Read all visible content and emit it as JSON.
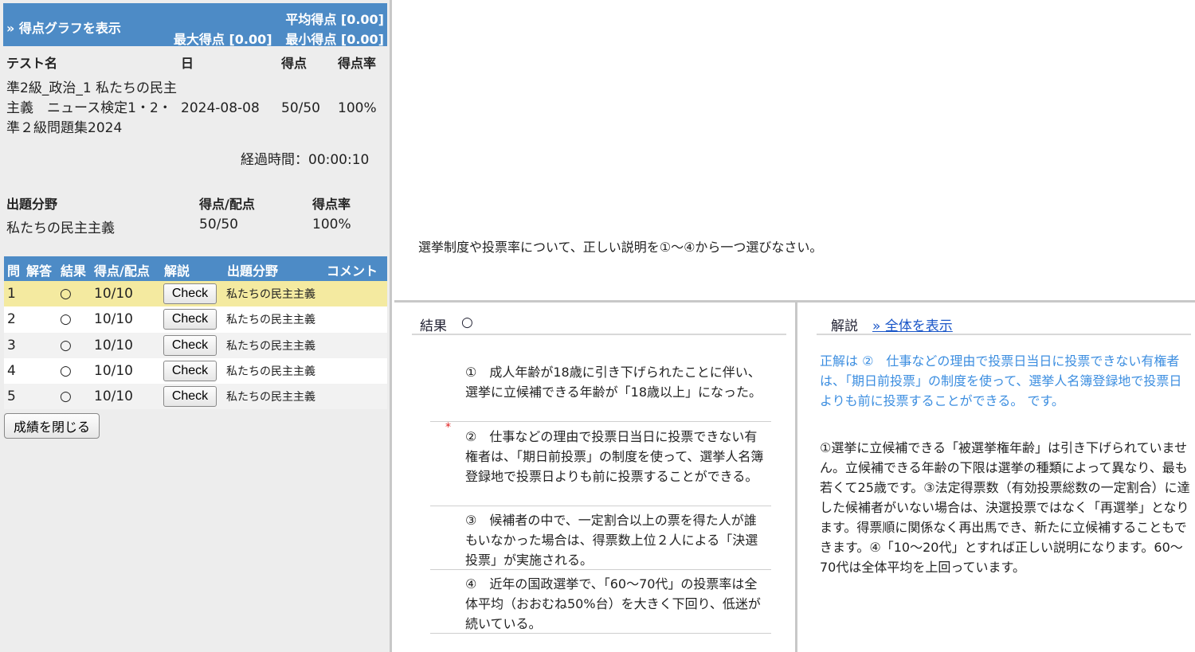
{
  "graph_bar": {
    "link": "» 得点グラフを表示",
    "avg": "平均得点 [0.00]",
    "max": "最大得点 [0.00]",
    "min": "最小得点 [0.00]"
  },
  "score_table": {
    "headers": [
      "テスト名",
      "日",
      "得点",
      "得点率"
    ],
    "test_name": "準2級_政治_1 私たちの民主主義　ニュース検定1・2・準２級問題集2024",
    "date": "2024-08-08",
    "score": "50/50",
    "rate": "100%"
  },
  "elapsed": "経過時間：00:00:10",
  "field_table": {
    "headers": [
      "出題分野",
      "得点/配点",
      "得点率"
    ],
    "field": "私たちの民主主義",
    "score": "50/50",
    "rate": "100%"
  },
  "question_table": {
    "headers": [
      "問",
      "解答",
      "結果",
      "得点/配点",
      "解説",
      "出題分野",
      "コメント"
    ],
    "rows": [
      {
        "num": "1",
        "result": "○",
        "score": "10/10",
        "button": "Check",
        "field": "私たちの民主主義"
      },
      {
        "num": "2",
        "result": "○",
        "score": "10/10",
        "button": "Check",
        "field": "私たちの民主主義"
      },
      {
        "num": "3",
        "result": "○",
        "score": "10/10",
        "button": "Check",
        "field": "私たちの民主主義"
      },
      {
        "num": "4",
        "result": "○",
        "score": "10/10",
        "button": "Check",
        "field": "私たちの民主主義"
      },
      {
        "num": "5",
        "result": "○",
        "score": "10/10",
        "button": "Check",
        "field": "私たちの民主主義"
      }
    ]
  },
  "close_button": "成績を閉じる",
  "question_text": "選挙制度や投票率について、正しい説明を①〜④から一つ選びなさい。",
  "result_panel": {
    "label": "結果",
    "mark": "○",
    "options": [
      {
        "text": "①　成人年齢が18歳に引き下げられたことに伴い、選挙に立候補できる年齢が「18歳以上」になった。",
        "star": ""
      },
      {
        "text": "②　仕事などの理由で投票日当日に投票できない有権者は、「期日前投票」の制度を使って、選挙人名簿登録地で投票日よりも前に投票することができる。",
        "star": "*"
      },
      {
        "text": "③　候補者の中で、一定割合以上の票を得た人が誰もいなかった場合は、得票数上位２人による「決選投票」が実施される。",
        "star": ""
      },
      {
        "text": "④　近年の国政選挙で、「60〜70代」の投票率は全体平均（おおむね50%台）を大きく下回り、低迷が続いている。",
        "star": ""
      }
    ]
  },
  "explanation_panel": {
    "label": "解説",
    "link": "» 全体を表示",
    "answer": "正解は ②　仕事などの理由で投票日当日に投票できない有権者は、「期日前投票」の制度を使って、選挙人名簿登録地で投票日よりも前に投票することができる。 です。",
    "body": "①選挙に立候補できる「被選挙権年齢」は引き下げられていません。立候補できる年齢の下限は選挙の種類によって異なり、最も若くて25歳です。③法定得票数（有効投票総数の一定割合）に達した候補者がいない場合は、決選投票ではなく「再選挙」となります。得票順に関係なく再出馬でき、新たに立候補することもできます。④「10〜20代」とすれば正しい説明になります。60〜70代は全体平均を上回っています。"
  }
}
